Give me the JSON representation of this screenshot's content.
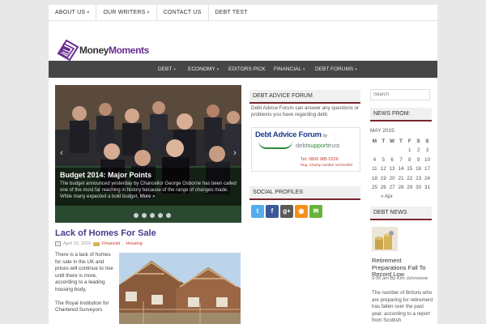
{
  "top_menu": [
    {
      "label": "About Us",
      "has_dropdown": true
    },
    {
      "label": "Our Writers",
      "has_dropdown": true
    },
    {
      "label": "Contact Us",
      "has_dropdown": false
    },
    {
      "label": "Debt Test",
      "has_dropdown": false
    }
  ],
  "logo": {
    "part1": "Money",
    "part2": "Moments",
    "brand_color": "#6a2c91"
  },
  "main_nav": [
    {
      "label": "Debt",
      "has_dropdown": true
    },
    {
      "label": "Economy",
      "has_dropdown": true
    },
    {
      "label": "Editors Pick",
      "has_dropdown": false
    },
    {
      "label": "Financial",
      "has_dropdown": true
    },
    {
      "label": "Debt Forums",
      "has_dropdown": true
    }
  ],
  "slider": {
    "title": "Budget 2014: Major Points",
    "excerpt": "The budget announced yesterday by Chancellor George Osborne has been called one of the most far reaching in history because of the range of changes made. While many expected a bold budget,",
    "more": "More »",
    "prev_icon": "chevron-left-icon",
    "next_icon": "chevron-right-icon",
    "slide_count": 5
  },
  "post": {
    "title": "Lack of Homes For Sale",
    "date": "April 10, 2014",
    "categories": [
      "Financial",
      "Housing"
    ],
    "excerpt": [
      "There is a lack of homes for sale in the UK and prices will continue to rise until there is more, according to a leading housing body.",
      "The Royal Institution for Chartered Surveyors"
    ]
  },
  "widgets": {
    "debt_advice_forum": {
      "title": "Debt Advice Forum",
      "text": "Debt Advice Forum can answer any questions or problems you have regarding debt.",
      "banner_title": "Debt Advice Forum",
      "banner_by": "by",
      "banner_brand_a": "debt",
      "banner_brand_b": "support",
      "banner_brand_c": "trust",
      "banner_tel": "Tel: 0800 085 0226",
      "banner_reg": "Reg. Charity number SC041903"
    },
    "social_profiles": {
      "title": "Social Profiles",
      "icons": [
        {
          "name": "twitter-icon",
          "glyph": "t",
          "color": "#55acee"
        },
        {
          "name": "facebook-icon",
          "glyph": "f",
          "color": "#3b5998"
        },
        {
          "name": "google-plus-icon",
          "glyph": "g+",
          "color": "#5a5a5a"
        },
        {
          "name": "rss-icon",
          "glyph": "◉",
          "color": "#f58f1b"
        },
        {
          "name": "email-icon",
          "glyph": "✉",
          "color": "#69b33a"
        }
      ]
    },
    "search": {
      "placeholder": "Search"
    },
    "news_from": {
      "title": "News From:",
      "month": "MAY 2015",
      "weekdays": [
        "M",
        "T",
        "W",
        "T",
        "F",
        "S",
        "S"
      ],
      "weeks": [
        [
          "",
          "",
          "",
          "",
          "1",
          "2",
          "3"
        ],
        [
          "4",
          "5",
          "6",
          "7",
          "8",
          "9",
          "10"
        ],
        [
          "11",
          "12",
          "13",
          "14",
          "15",
          "16",
          "17"
        ],
        [
          "18",
          "19",
          "20",
          "21",
          "22",
          "23",
          "24"
        ],
        [
          "25",
          "26",
          "27",
          "28",
          "29",
          "30",
          "31"
        ]
      ],
      "prev": "« Apr"
    },
    "debt_news": {
      "title": "Debt News",
      "item_title": "Retirement Preparations Fall To Record Low",
      "item_meta": "9:55 am By Kim Johnstone",
      "item_text": "The number of Britons who are preparing for retirement has fallen over the past year, according to a report from Scottish"
    }
  },
  "colors": {
    "nav_bg": "#464646",
    "widget_accent": "#7a2530",
    "post_title": "#4a3b8c"
  }
}
